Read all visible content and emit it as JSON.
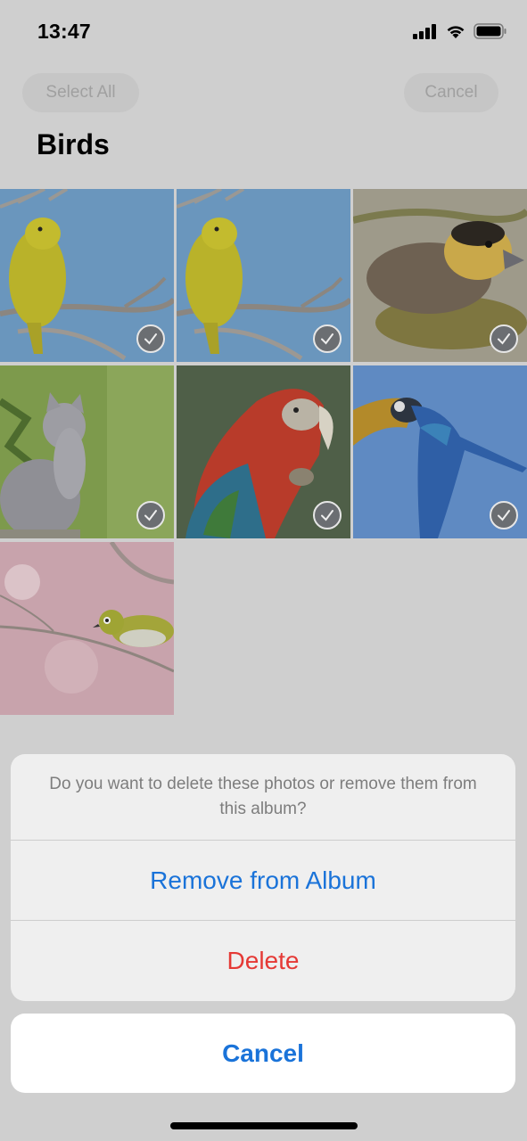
{
  "status_bar": {
    "time": "13:47",
    "icons": [
      "cellular-signal-icon",
      "wifi-icon",
      "battery-icon"
    ]
  },
  "nav": {
    "select_all_label": "Select All",
    "cancel_label": "Cancel"
  },
  "album": {
    "title": "Birds",
    "photos": [
      {
        "subject": "yellow canary on branch",
        "selected": true
      },
      {
        "subject": "yellow canary on branch",
        "selected": true
      },
      {
        "subject": "duckling in water",
        "selected": true
      },
      {
        "subject": "grey kitten",
        "selected": true
      },
      {
        "subject": "red macaw",
        "selected": true
      },
      {
        "subject": "blue-and-yellow macaw in flight",
        "selected": true
      },
      {
        "subject": "white-eye bird on blossom branch",
        "selected": false
      }
    ]
  },
  "action_sheet": {
    "message": "Do you want to delete these photos or remove them from this album?",
    "remove_label": "Remove from Album",
    "delete_label": "Delete",
    "cancel_label": "Cancel",
    "colors": {
      "accent": "#1a73d9",
      "destructive": "#e53935"
    }
  }
}
